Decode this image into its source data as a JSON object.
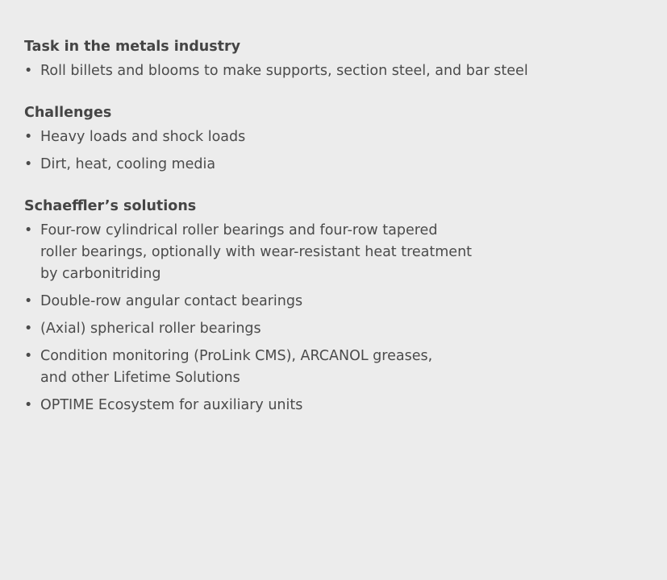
{
  "sections": [
    {
      "heading": "Task in the metals industry",
      "items": [
        "Roll billets and blooms to make supports, section steel, and bar steel"
      ]
    },
    {
      "heading": "Challenges",
      "items": [
        "Heavy loads and shock loads",
        "Dirt, heat, cooling media"
      ]
    },
    {
      "heading": "Schaeffler’s solutions",
      "items": [
        "Four-row cylindrical roller bearings and four-row tapered\nroller bearings, optionally with wear-resistant heat treatment\nby carbonitriding",
        "Double-row angular contact bearings",
        "(Axial) spherical roller bearings",
        "Condition monitoring (ProLink CMS), ARCANOL greases,\nand other Lifetime Solutions",
        "OPTIME Ecosystem for auxiliary units"
      ]
    }
  ],
  "bullet_glyph": "•"
}
